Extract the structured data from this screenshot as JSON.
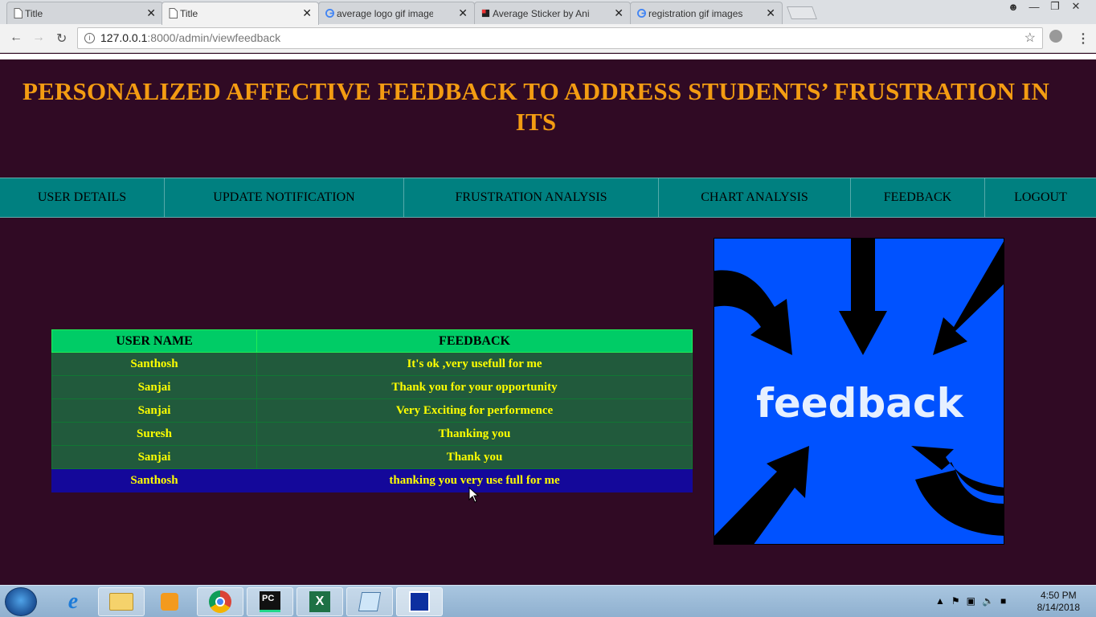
{
  "browser": {
    "tabs": [
      {
        "label": "Title",
        "active": false,
        "icon": "page-icon"
      },
      {
        "label": "Title",
        "active": true,
        "icon": "page-icon"
      },
      {
        "label": "average logo gif images",
        "active": false,
        "icon": "google-icon"
      },
      {
        "label": "Average Sticker by Anima",
        "active": false,
        "icon": "sticker-icon"
      },
      {
        "label": "registration gif images - G",
        "active": false,
        "icon": "google-icon"
      }
    ],
    "url_host": "127.0.0.1",
    "url_path": ":8000/admin/viewfeedback"
  },
  "page": {
    "title": "PERSONALIZED AFFECTIVE FEEDBACK TO ADDRESS STUDENTS’ FRUSTRATION IN ITS",
    "nav": [
      {
        "label": "USER DETAILS"
      },
      {
        "label": "UPDATE NOTIFICATION"
      },
      {
        "label": "FRUSTRATION ANALYSIS"
      },
      {
        "label": "CHART ANALYSIS"
      },
      {
        "label": "FEEDBACK"
      },
      {
        "label": "LOGOUT"
      }
    ],
    "table": {
      "headers": [
        "USER NAME",
        "FEEDBACK"
      ],
      "rows": [
        {
          "user": "Santhosh",
          "feedback": "It's ok ,very usefull for me"
        },
        {
          "user": "Sanjai",
          "feedback": "Thank you for your opportunity"
        },
        {
          "user": "Sanjai",
          "feedback": "Very Exciting for performence"
        },
        {
          "user": "Suresh",
          "feedback": "Thanking you"
        },
        {
          "user": "Sanjai",
          "feedback": "Thank you"
        },
        {
          "user": "Santhosh",
          "feedback": "thanking you very use full for me"
        }
      ]
    },
    "image_text": "feedback"
  },
  "taskbar": {
    "time": "4:50 PM",
    "date": "8/14/2018"
  },
  "colors": {
    "page_bg": "#300a24",
    "title": "#f39c12",
    "nav_bg": "#008080",
    "table_header": "#00cc66",
    "row_bg": "#215a3c",
    "row_text": "#ffff00",
    "selected_row": "#14089a",
    "image_bg": "#0052ff"
  }
}
